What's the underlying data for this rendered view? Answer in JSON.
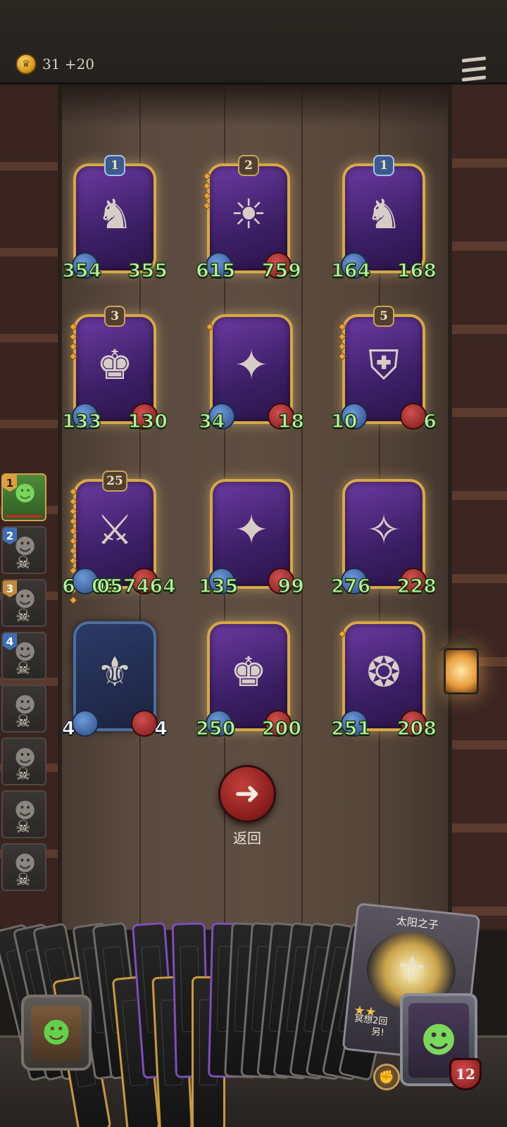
{
  "header": {
    "gold_icon": "crown-coin-icon",
    "gold_text": "31 +20",
    "menu_icon": "hamburger-menu-icon"
  },
  "board": {
    "cards": [
      {
        "level": "1",
        "level_style": "blue-banner",
        "atk": "354",
        "hp": "355",
        "has_hp_orb": false,
        "pips": 0,
        "art": "unicorn-knight-icon"
      },
      {
        "level": "2",
        "level_style": "gold",
        "atk": "615",
        "hp": "759",
        "has_hp_orb": true,
        "pips": 4,
        "art": "sun-boy-icon"
      },
      {
        "level": "1",
        "level_style": "blue-banner",
        "atk": "164",
        "hp": "168",
        "has_hp_orb": false,
        "pips": 0,
        "art": "unicorn-knight-icon"
      },
      {
        "level": "3",
        "level_style": "gold",
        "atk": "133",
        "hp": "130",
        "has_hp_orb": true,
        "pips": 4,
        "art": "bearded-king-icon"
      },
      {
        "level": "",
        "level_style": "none",
        "atk": "34",
        "hp": "18",
        "has_hp_orb": true,
        "pips": 1,
        "art": "blue-hair-mage-icon"
      },
      {
        "level": "5",
        "level_style": "gold",
        "atk": "10",
        "hp": "6",
        "has_hp_orb": true,
        "pips": 4,
        "art": "shield-knight-icon"
      },
      {
        "level": "25",
        "level_style": "gold",
        "atk": "6",
        "hp": "057464",
        "atk_overlay": "05",
        "has_hp_orb": true,
        "pips": 12,
        "art": "twin-assassins-icon"
      },
      {
        "level": "",
        "level_style": "none",
        "atk": "135",
        "hp": "99",
        "has_hp_orb": true,
        "pips": 0,
        "art": "blue-hair-mage-icon"
      },
      {
        "level": "",
        "level_style": "none",
        "atk": "276",
        "hp": "228",
        "has_hp_orb": true,
        "pips": 0,
        "art": "elf-sorceress-icon"
      },
      {
        "level": "",
        "level_style": "none",
        "atk": "4",
        "hp": "4",
        "has_hp_orb": true,
        "pips": 0,
        "art": "sun-paladin-icon",
        "blue": true
      },
      {
        "level": "",
        "level_style": "none",
        "atk": "250",
        "hp": "200",
        "has_hp_orb": true,
        "pips": 0,
        "art": "bearded-king-icon"
      },
      {
        "level": "",
        "level_style": "none",
        "atk": "251",
        "hp": "208",
        "has_hp_orb": true,
        "pips": 1,
        "art": "elf-priestess-icon"
      }
    ]
  },
  "return_button": {
    "label": "返回",
    "icon": "arrow-left-icon"
  },
  "opponents": [
    {
      "rank": "1",
      "active": true
    },
    {
      "rank": "2",
      "active": false
    },
    {
      "rank": "3",
      "active": false
    },
    {
      "rank": "4",
      "active": false
    },
    {
      "rank": "",
      "active": false
    },
    {
      "rank": "",
      "active": false
    },
    {
      "rank": "",
      "active": false
    },
    {
      "rank": "",
      "active": false
    }
  ],
  "hand": {
    "featured_card": {
      "title": "太阳之子",
      "stars": "★★",
      "desc_line1": "冥想2回",
      "desc_line2": "另!"
    },
    "player_hp": "12",
    "ability_icon": "fist-icon"
  }
}
